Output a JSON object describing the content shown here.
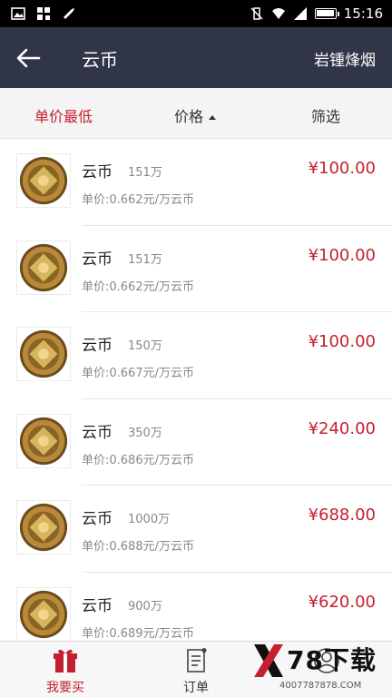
{
  "status_bar": {
    "time": "15:16"
  },
  "header": {
    "title": "云币",
    "right_title": "岩锺烽烟"
  },
  "sort": {
    "lowest_unit_price": "单价最低",
    "price": "价格",
    "filter": "筛选"
  },
  "items": [
    {
      "name": "云币",
      "qty": "151万",
      "price": "¥100.00",
      "unit_price": "单价:0.662元/万云币"
    },
    {
      "name": "云币",
      "qty": "151万",
      "price": "¥100.00",
      "unit_price": "单价:0.662元/万云币"
    },
    {
      "name": "云币",
      "qty": "150万",
      "price": "¥100.00",
      "unit_price": "单价:0.667元/万云币"
    },
    {
      "name": "云币",
      "qty": "350万",
      "price": "¥240.00",
      "unit_price": "单价:0.686元/万云币"
    },
    {
      "name": "云币",
      "qty": "1000万",
      "price": "¥688.00",
      "unit_price": "单价:0.688元/万云币"
    },
    {
      "name": "云币",
      "qty": "900万",
      "price": "¥620.00",
      "unit_price": "单价:0.689元/万云币"
    }
  ],
  "tabs": {
    "buy": "我要买",
    "orders": "订单"
  },
  "watermark": {
    "brand": "78下载",
    "phone": "4007787878.COM"
  },
  "colors": {
    "accent": "#c5202f",
    "header_bg": "#303547"
  }
}
